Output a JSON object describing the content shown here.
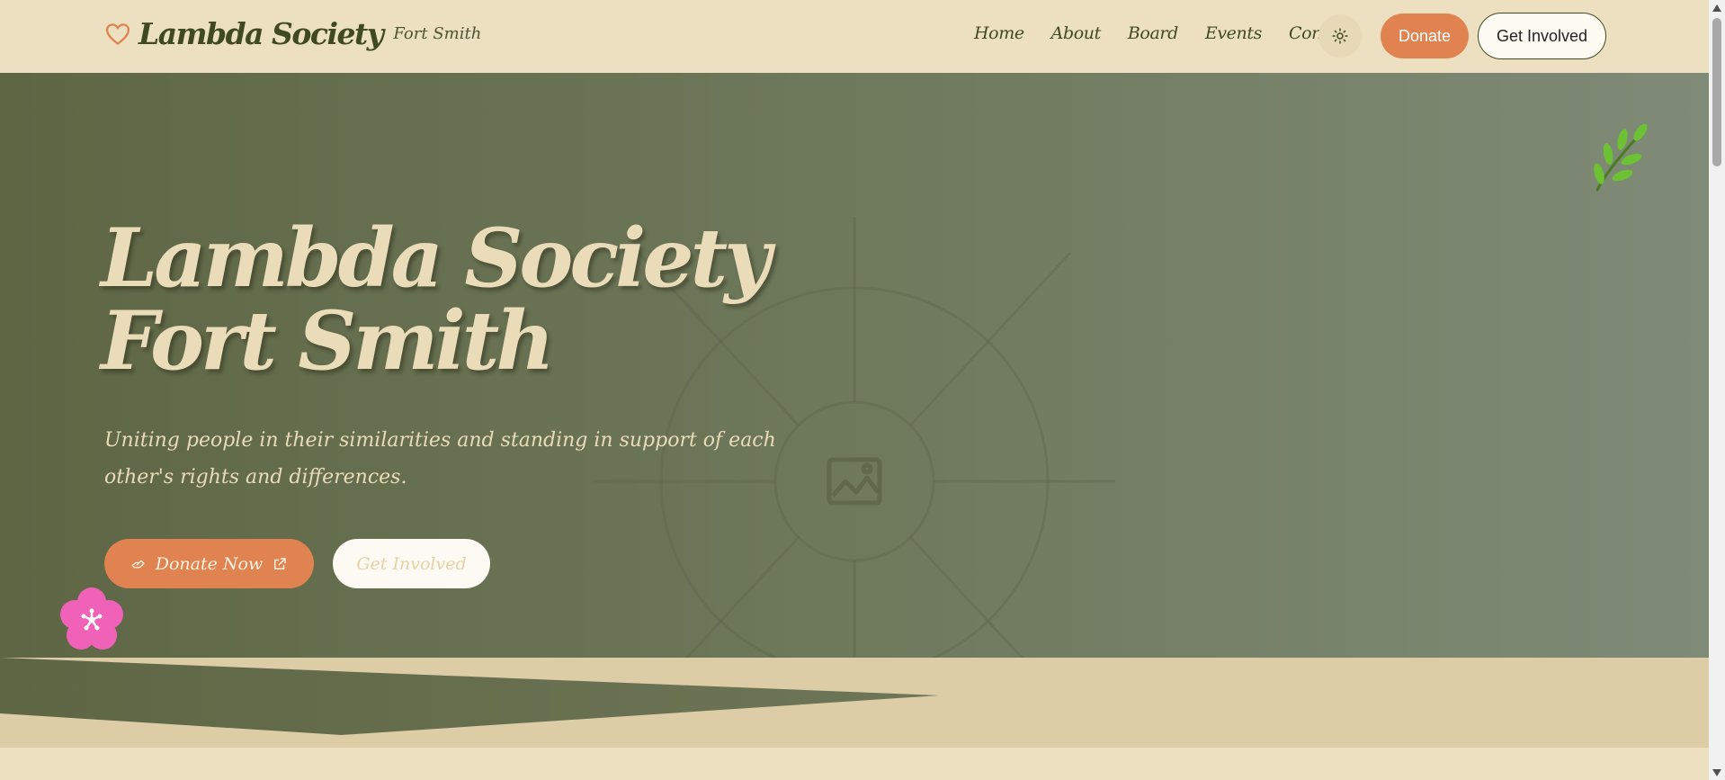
{
  "header": {
    "brand_title": "Lambda Society",
    "brand_subtitle": "Fort Smith",
    "nav": [
      "Home",
      "About",
      "Board",
      "Events",
      "Contact"
    ],
    "donate_label": "Donate",
    "get_involved_label": "Get Involved"
  },
  "hero": {
    "title_line1": "Lambda Society",
    "title_line2": "Fort Smith",
    "tagline": "Uniting people in their similarities and standing in support of each other's rights and differences.",
    "donate_now_label": "Donate Now",
    "get_involved_label": "Get Involved"
  },
  "icons": {
    "brand": "heart-icon",
    "theme_toggle": "sun-icon",
    "donate_now_leading": "hand-heart-icon",
    "donate_now_trailing": "external-link-icon",
    "hero_placeholder": "image-icon",
    "decor_left": "flower-icon",
    "decor_right": "leaf-sprig-icon"
  },
  "colors": {
    "page_bg": "#ede0c0",
    "accent_orange": "#e08350",
    "olive_dark": "#3f4a22",
    "hero_start": "#5e6644",
    "hero_end": "#7f8b77",
    "hero_text": "#eadcb9"
  }
}
